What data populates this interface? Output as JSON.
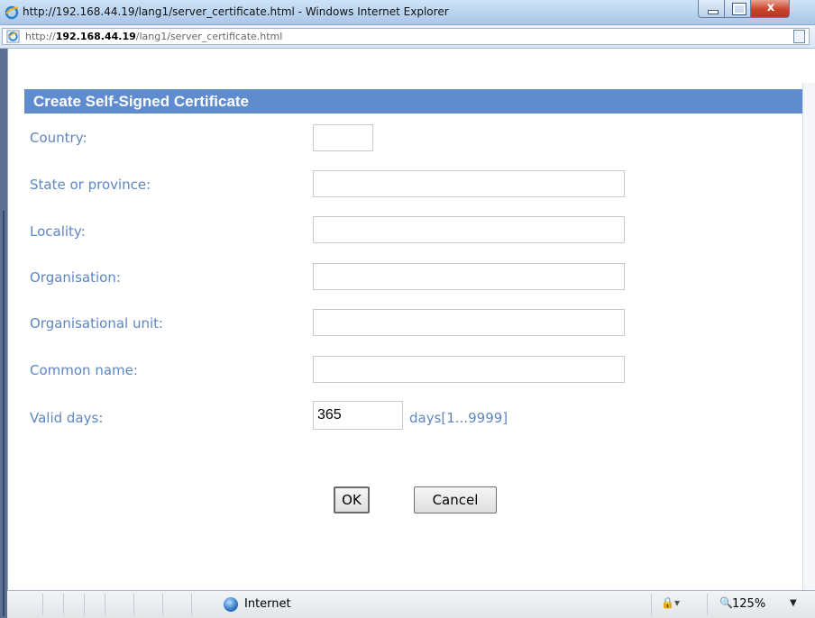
{
  "window": {
    "title": "http://192.168.44.19/lang1/server_certificate.html - Windows Internet Explorer",
    "close_glyph": "x"
  },
  "address": {
    "prefix": "http://",
    "host": "192.168.44.19",
    "path": "/lang1/server_certificate.html"
  },
  "form": {
    "heading": "Create Self-Signed Certificate",
    "fields": [
      {
        "label": "Country:",
        "value": ""
      },
      {
        "label": "State or province:",
        "value": ""
      },
      {
        "label": "Locality:",
        "value": ""
      },
      {
        "label": "Organisation:",
        "value": ""
      },
      {
        "label": "Organisational unit:",
        "value": ""
      },
      {
        "label": "Common name:",
        "value": ""
      }
    ],
    "valid_days": {
      "label": "Valid days:",
      "value": "365",
      "unit": "days[1...9999]"
    },
    "ok_label": "OK",
    "cancel_label": "Cancel"
  },
  "status": {
    "zone": "Internet",
    "zoom": "125%",
    "zoom_arrow": "▼",
    "security_glyph": "▾"
  },
  "colors": {
    "header_bar": "#5f8ccf",
    "label_text": "#5d86c2"
  },
  "icons": [
    "ie-logo-icon",
    "page-icon",
    "globe-icon",
    "security-icon",
    "zoom-icon",
    "minimize-icon",
    "maximize-icon",
    "close-icon"
  ]
}
